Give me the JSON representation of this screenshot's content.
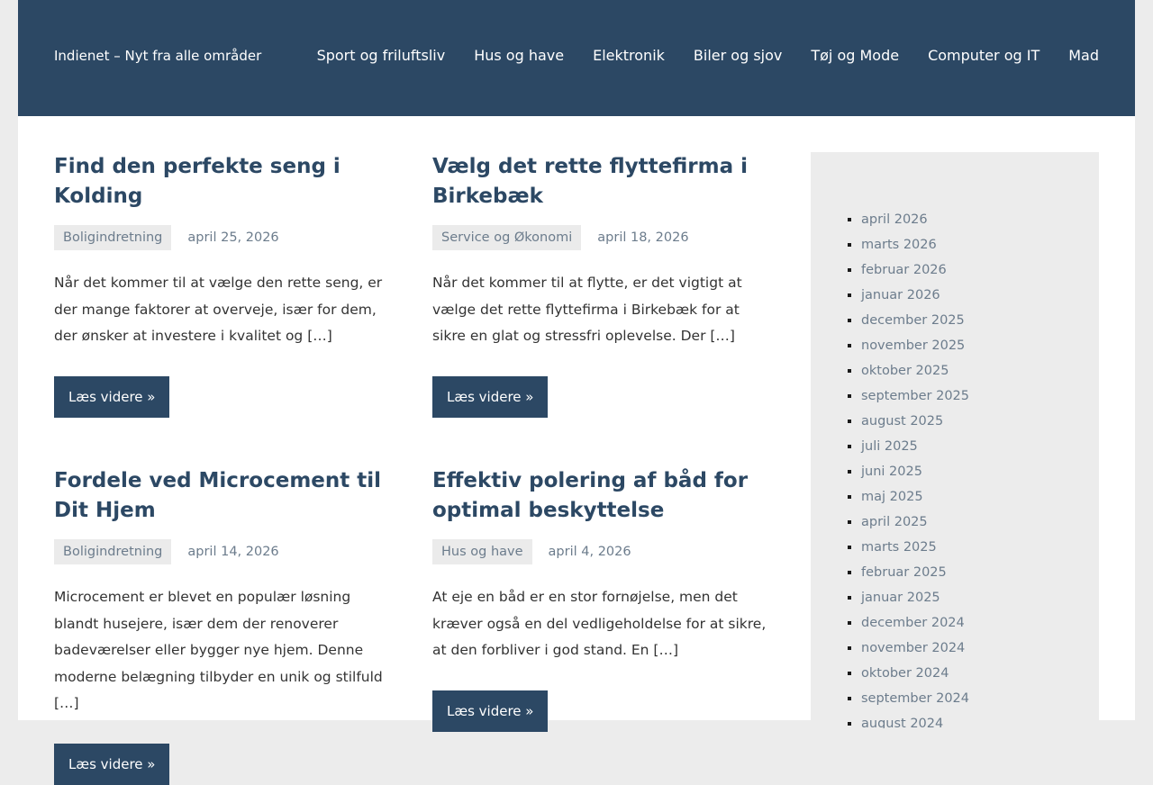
{
  "site": {
    "title": "Indienet – Nyt fra alle områder"
  },
  "nav": [
    "Sport og friluftsliv",
    "Hus og have",
    "Elektronik",
    "Biler og sjov",
    "Tøj og Mode",
    "Computer og IT",
    "Mad"
  ],
  "posts": [
    {
      "title": "Find den perfekte seng i Kolding",
      "category": "Boligindretning",
      "date": "april 25, 2026",
      "excerpt": "Når det kommer til at vælge den rette seng, er der mange faktorer at overveje, især for dem, der ønsker at investere i kvalitet og […]",
      "more": "Læs videre »"
    },
    {
      "title": "Vælg det rette flyttefirma i Birkebæk",
      "category": "Service og Økonomi",
      "date": "april 18, 2026",
      "excerpt": "Når det kommer til at flytte, er det vigtigt at vælge det rette flyttefirma i Birkebæk for at sikre en glat og stressfri oplevelse. Der […]",
      "more": "Læs videre »"
    },
    {
      "title": "Fordele ved Microcement til Dit Hjem",
      "category": "Boligindretning",
      "date": "april 14, 2026",
      "excerpt": "Microcement er blevet en populær løsning blandt husejere, især dem der renoverer badeværelser eller bygger nye hjem. Denne moderne belægning tilbyder en unik og stilfuld […]",
      "more": "Læs videre »"
    },
    {
      "title": "Effektiv polering af båd for optimal beskyttelse",
      "category": "Hus og have",
      "date": "april 4, 2026",
      "excerpt": "At eje en båd er en stor fornøjelse, men det kræver også en del vedligeholdelse for at sikre, at den forbliver i god stand. En […]",
      "more": "Læs videre »"
    }
  ],
  "archive": [
    "april 2026",
    "marts 2026",
    "februar 2026",
    "januar 2026",
    "december 2025",
    "november 2025",
    "oktober 2025",
    "september 2025",
    "august 2025",
    "juli 2025",
    "juni 2025",
    "maj 2025",
    "april 2025",
    "marts 2025",
    "februar 2025",
    "januar 2025",
    "december 2024",
    "november 2024",
    "oktober 2024",
    "september 2024",
    "august 2024"
  ]
}
